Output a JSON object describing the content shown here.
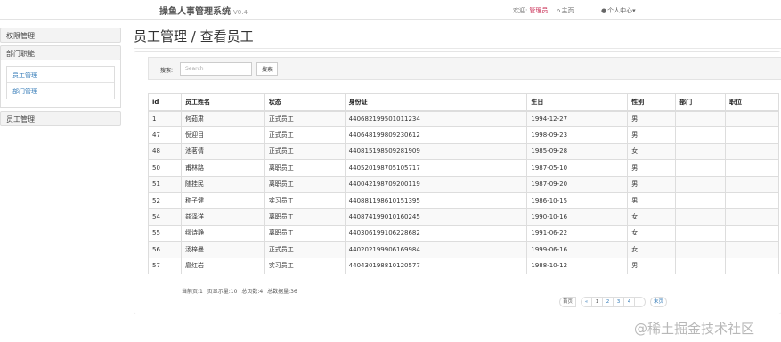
{
  "header": {
    "app_title": "操鱼人事管理系统",
    "version": "V0.4",
    "welcome_text": "欢迎:",
    "admin_name": "管理员",
    "home_label": "主页",
    "user_center_label": "个人中心"
  },
  "sidebar": {
    "sections": [
      {
        "label": "权限管理"
      },
      {
        "label": "部门职能"
      },
      {
        "label": "员工管理"
      }
    ],
    "sub_items": [
      {
        "label": "员工管理"
      },
      {
        "label": "部门管理"
      }
    ]
  },
  "main": {
    "title": "员工管理 / 查看员工",
    "search": {
      "label": "搜索:",
      "placeholder": "Search",
      "button_label": "搜索"
    },
    "table": {
      "columns": [
        "id",
        "员工姓名",
        "状态",
        "身份证",
        "生日",
        "性别",
        "部门",
        "职位"
      ],
      "rows": [
        [
          "1",
          "何茹肃",
          "正式员工",
          "440682199501011234",
          "1994-12-27",
          "男",
          "",
          ""
        ],
        [
          "47",
          "倪迎目",
          "正式员工",
          "440648199809230612",
          "1998-09-23",
          "男",
          "",
          ""
        ],
        [
          "48",
          "池茗倩",
          "正式员工",
          "440815198509281909",
          "1985-09-28",
          "女",
          "",
          ""
        ],
        [
          "50",
          "甫林路",
          "离职员工",
          "440520198705105717",
          "1987-05-10",
          "男",
          "",
          ""
        ],
        [
          "51",
          "随挂民",
          "离职员工",
          "440042198709200119",
          "1987-09-20",
          "男",
          "",
          ""
        ],
        [
          "52",
          "称子健",
          "实习员工",
          "440881198610151395",
          "1986-10-15",
          "男",
          "",
          ""
        ],
        [
          "54",
          "兹泽洋",
          "离职员工",
          "440874199010160245",
          "1990-10-16",
          "女",
          "",
          ""
        ],
        [
          "55",
          "缪诗静",
          "离职员工",
          "440306199106228682",
          "1991-06-22",
          "女",
          "",
          ""
        ],
        [
          "56",
          "汤梓曼",
          "正式员工",
          "440202199906169984",
          "1999-06-16",
          "女",
          "",
          ""
        ],
        [
          "57",
          "扈红岩",
          "实习员工",
          "440430198810120577",
          "1988-10-12",
          "男",
          "",
          ""
        ]
      ]
    },
    "page_info": {
      "current": "当前页:1",
      "page_size": "页显示量:10",
      "total_pages": "总页数:4",
      "total_records": "总数据量:36"
    },
    "pagination": {
      "first": "首页",
      "prev": "«",
      "pages": [
        "1",
        "2",
        "3",
        "4"
      ],
      "next": "",
      "last": "末页"
    }
  },
  "watermark": "@稀土掘金技术社区"
}
